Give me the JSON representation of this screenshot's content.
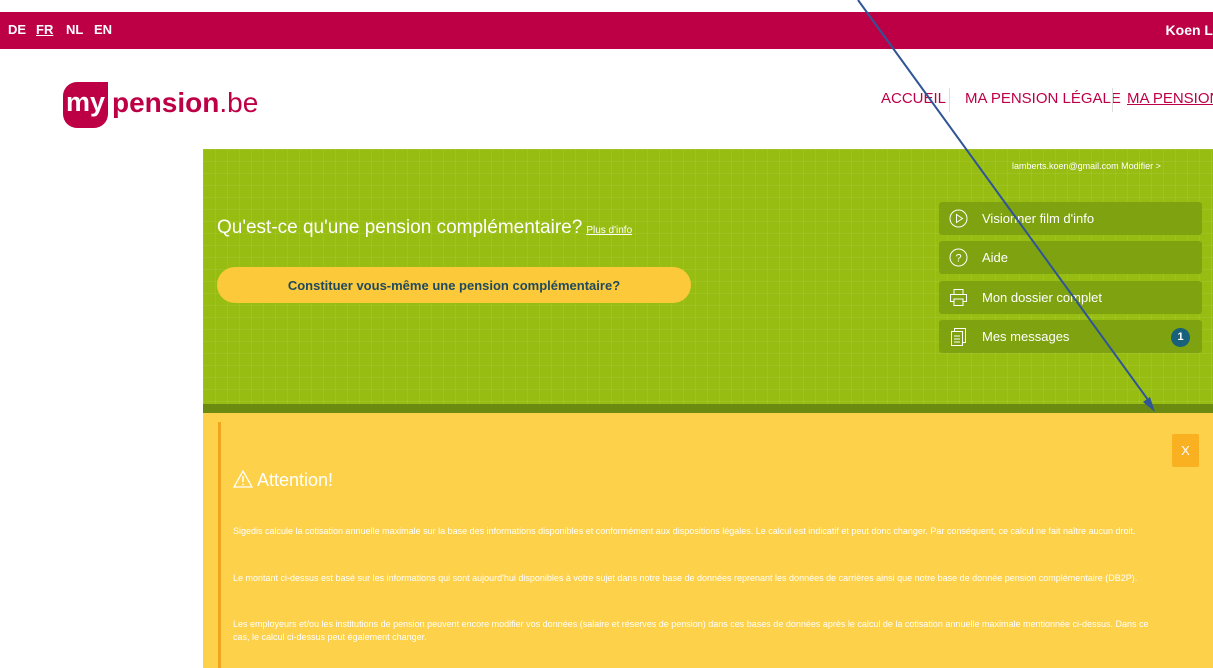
{
  "topbar": {
    "languages": [
      "DE",
      "FR",
      "NL",
      "EN"
    ],
    "active_language": "FR",
    "user_name": "Koen L"
  },
  "logo": {
    "prefix": "my",
    "middle": "pension",
    "suffix": ".be"
  },
  "nav": {
    "items": [
      "ACCUEIL",
      "MA PENSION LÉGALE",
      "MA PENSION"
    ],
    "current": "MA PENSION"
  },
  "panel": {
    "email_link": "lamberts.koen@gmail.com Modifier  >",
    "question": "Qu'est-ce qu'une pension complémentaire?",
    "more_info": "Plus d'info",
    "cta": "Constituer vous-même une pension complémentaire?",
    "side_buttons": [
      {
        "icon": "play-circle-icon",
        "label": "Visionner film d'info"
      },
      {
        "icon": "help-circle-icon",
        "label": "Aide"
      },
      {
        "icon": "printer-icon",
        "label": "Mon dossier complet"
      },
      {
        "icon": "document-icon",
        "label": "Mes messages",
        "badge": "1"
      }
    ],
    "colors": {
      "green": "#98bd12",
      "button": "#7ea210",
      "cta": "#fcc93a",
      "badge": "#19607a"
    }
  },
  "alert": {
    "close": "X",
    "title": "Attention!",
    "paragraphs": [
      "Sigedis calcule la cotisation annuelle maximale sur la base des informations disponibles et conformément aux dispositions légales. Le calcul est indicatif et peut donc changer. Par conséquent, ce calcul ne fait naître aucun droit.",
      "Le montant ci-dessus est basé sur les informations qui sont aujourd'hui disponibles à votre sujet dans notre base de données reprenant les données de carrières ainsi que notre base de donnée pension complémentaire (DB2P).",
      "Les employeurs et/ou les institutions de pension peuvent encore modifier vos données (salaire et réserves de pension) dans ces bases de données après le calcul de la cotisation annuelle maximale mentionnée ci-dessus. Dans ce cas, le calcul ci-dessus peut également changer."
    ],
    "colors": {
      "background": "#fdd14a",
      "close": "#f9b021"
    }
  },
  "brand_color": "#bd0046"
}
